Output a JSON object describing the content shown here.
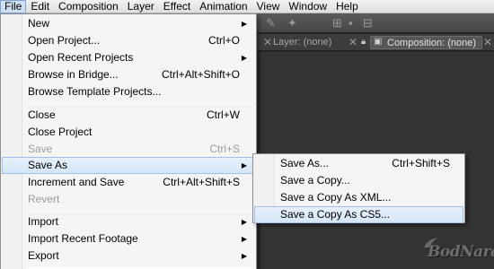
{
  "menubar": {
    "items": [
      "File",
      "Edit",
      "Composition",
      "Layer",
      "Effect",
      "Animation",
      "View",
      "Window",
      "Help"
    ]
  },
  "panels": {
    "layer_tab": "Layer: (none)",
    "composition_tab": "Composition: (none)"
  },
  "file_menu": {
    "items": [
      {
        "label": "New",
        "shortcut": "",
        "submenu": true,
        "disabled": false
      },
      {
        "label": "Open Project...",
        "shortcut": "Ctrl+O",
        "submenu": false,
        "disabled": false
      },
      {
        "label": "Open Recent Projects",
        "shortcut": "",
        "submenu": true,
        "disabled": false
      },
      {
        "label": "Browse in Bridge...",
        "shortcut": "Ctrl+Alt+Shift+O",
        "submenu": false,
        "disabled": false
      },
      {
        "label": "Browse Template Projects...",
        "shortcut": "",
        "submenu": false,
        "disabled": false
      },
      {
        "label": "Close",
        "shortcut": "Ctrl+W",
        "submenu": false,
        "disabled": false
      },
      {
        "label": "Close Project",
        "shortcut": "",
        "submenu": false,
        "disabled": false
      },
      {
        "label": "Save",
        "shortcut": "Ctrl+S",
        "submenu": false,
        "disabled": true
      },
      {
        "label": "Save As",
        "shortcut": "",
        "submenu": true,
        "disabled": false,
        "highlighted": true
      },
      {
        "label": "Increment and Save",
        "shortcut": "Ctrl+Alt+Shift+S",
        "submenu": false,
        "disabled": false
      },
      {
        "label": "Revert",
        "shortcut": "",
        "submenu": false,
        "disabled": true
      },
      {
        "label": "Import",
        "shortcut": "",
        "submenu": true,
        "disabled": false
      },
      {
        "label": "Import Recent Footage",
        "shortcut": "",
        "submenu": true,
        "disabled": false
      },
      {
        "label": "Export",
        "shortcut": "",
        "submenu": true,
        "disabled": false
      }
    ]
  },
  "save_as_submenu": {
    "items": [
      {
        "label": "Save As...",
        "shortcut": "Ctrl+Shift+S"
      },
      {
        "label": "Save a Copy...",
        "shortcut": ""
      },
      {
        "label": "Save a Copy As XML...",
        "shortcut": ""
      },
      {
        "label": "Save a Copy As CS5...",
        "shortcut": "",
        "highlighted": true
      }
    ]
  },
  "watermark": {
    "text": "BodNara"
  },
  "icons": {
    "submenu_arrow": "submenu-arrow-icon",
    "lock": "lock-icon",
    "close": "close-icon"
  },
  "colors": {
    "highlight": "#d4e5f7",
    "menu_bg": "#f5f5f5",
    "app_bg": "#2a2a2a"
  }
}
